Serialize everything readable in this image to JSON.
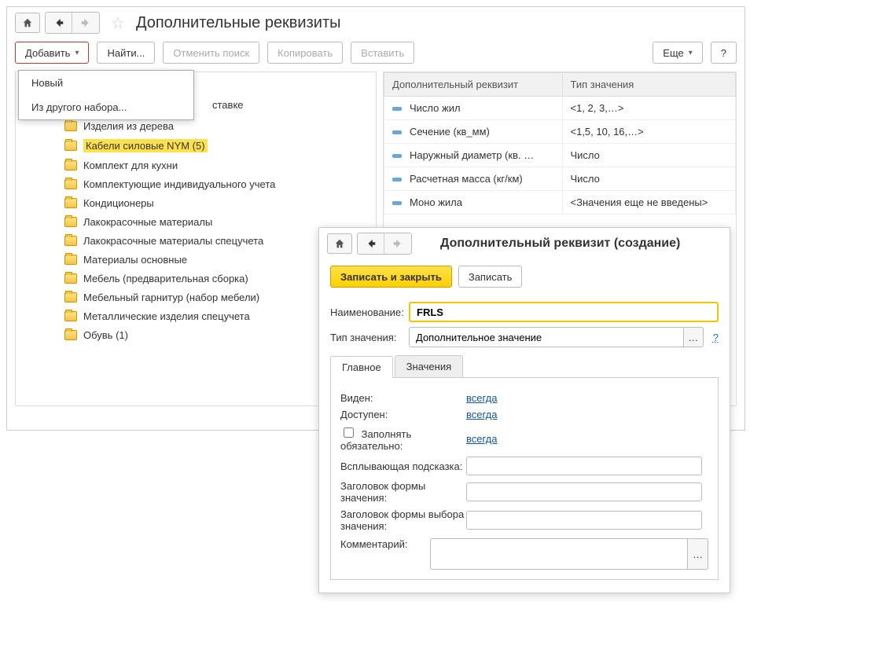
{
  "main": {
    "title": "Дополнительные реквизиты",
    "toolbar": {
      "add": "Добавить",
      "find": "Найти...",
      "cancelSearch": "Отменить поиск",
      "copy": "Копировать",
      "paste": "Вставить",
      "more": "Еще",
      "help": "?"
    },
    "addMenu": {
      "new": "Новый",
      "fromSet": "Из другого набора..."
    },
    "treePartial": "ставке",
    "tree": [
      "Изделия из дерева",
      "Кабели силовые NYM (5)",
      "Комплект для кухни",
      "Комплектующие индивидуального учета",
      "Кондиционеры",
      "Лакокрасочные материалы",
      "Лакокрасочные материалы спецучета",
      "Материалы основные",
      "Мебель (предварительная сборка)",
      "Мебельный гарнитур (набор мебели)",
      "Металлические изделия спецучета",
      "Обувь (1)"
    ],
    "treeSelectedIndex": 1,
    "table": {
      "headers": {
        "name": "Дополнительный реквизит",
        "type": "Тип значения"
      },
      "rows": [
        {
          "name": "Число жил",
          "type": "<1, 2, 3,…>"
        },
        {
          "name": "Сечение (кв_мм)",
          "type": "<1,5, 10, 16,…>"
        },
        {
          "name": "Наружный диаметр (кв. …",
          "type": "Число"
        },
        {
          "name": "Расчетная масса (кг/км)",
          "type": "Число"
        },
        {
          "name": "Моно жила",
          "type": "<Значения еще не введены>"
        }
      ]
    }
  },
  "dialog": {
    "title": "Дополнительный реквизит (создание)",
    "actions": {
      "saveClose": "Записать и закрыть",
      "save": "Записать"
    },
    "fields": {
      "nameLabel": "Наименование:",
      "nameValue": "FRLS",
      "typeLabel": "Тип значения:",
      "typeValue": "Дополнительное значение",
      "typeHelp": "?"
    },
    "tabs": {
      "main": "Главное",
      "values": "Значения"
    },
    "props": {
      "visibleLabel": "Виден:",
      "visibleValue": "всегда",
      "availableLabel": "Доступен:",
      "availableValue": "всегда",
      "mandatoryLabel": "Заполнять обязательно:",
      "mandatoryValue": "всегда",
      "tooltipLabel": "Всплывающая подсказка:",
      "valueFormTitleLabel": "Заголовок формы значения:",
      "valueChoiceFormTitleLabel": "Заголовок формы выбора значения:",
      "commentLabel": "Комментарий:"
    }
  }
}
